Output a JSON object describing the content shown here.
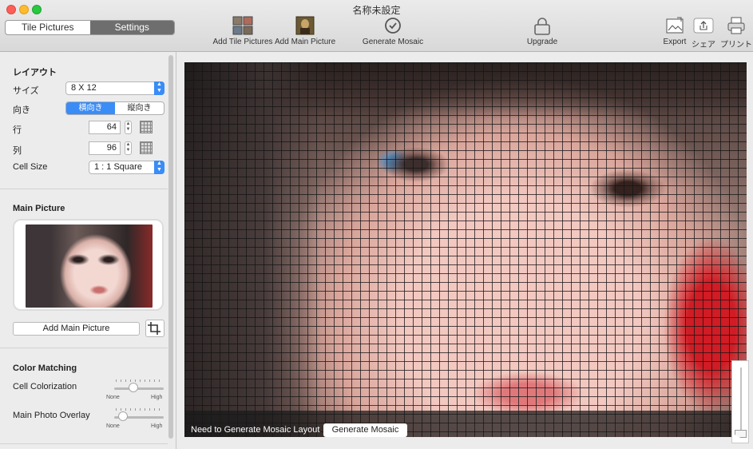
{
  "window": {
    "title": "名称未設定"
  },
  "tabs": [
    {
      "label": "Tile Pictures",
      "active": false
    },
    {
      "label": "Settings",
      "active": true
    }
  ],
  "toolbar": {
    "add_tile": "Add Tile Pictures",
    "add_main": "Add Main Picture",
    "generate": "Generate Mosaic",
    "upgrade": "Upgrade",
    "export": "Export",
    "share": "シェア",
    "print": "プリント"
  },
  "layout": {
    "title": "レイアウト",
    "size_label": "サイズ",
    "size_value": "8 X 12",
    "orientation_label": "向き",
    "orientation_options": [
      "横向き",
      "縦向き"
    ],
    "orientation_selected": "横向き",
    "rows_label": "行",
    "rows_value": "64",
    "cols_label": "列",
    "cols_value": "96",
    "cell_size_label": "Cell Size",
    "cell_size_value": "1 : 1 Square"
  },
  "main_picture": {
    "title": "Main Picture",
    "add_button": "Add Main Picture"
  },
  "color_matching": {
    "title": "Color Matching",
    "cell_colorization": {
      "label": "Cell Colorization",
      "min": "None",
      "max": "High",
      "value": 0.35
    },
    "main_photo_overlay": {
      "label": "Main Photo Overlay",
      "min": "None",
      "max": "High",
      "value": 0.1
    }
  },
  "canvas": {
    "notice": "Need to Generate Mosaic Layout",
    "button": "Generate Mosaic"
  },
  "colors": {
    "accent": "#3a8cf6",
    "segment_active": "#6e6e6e"
  }
}
